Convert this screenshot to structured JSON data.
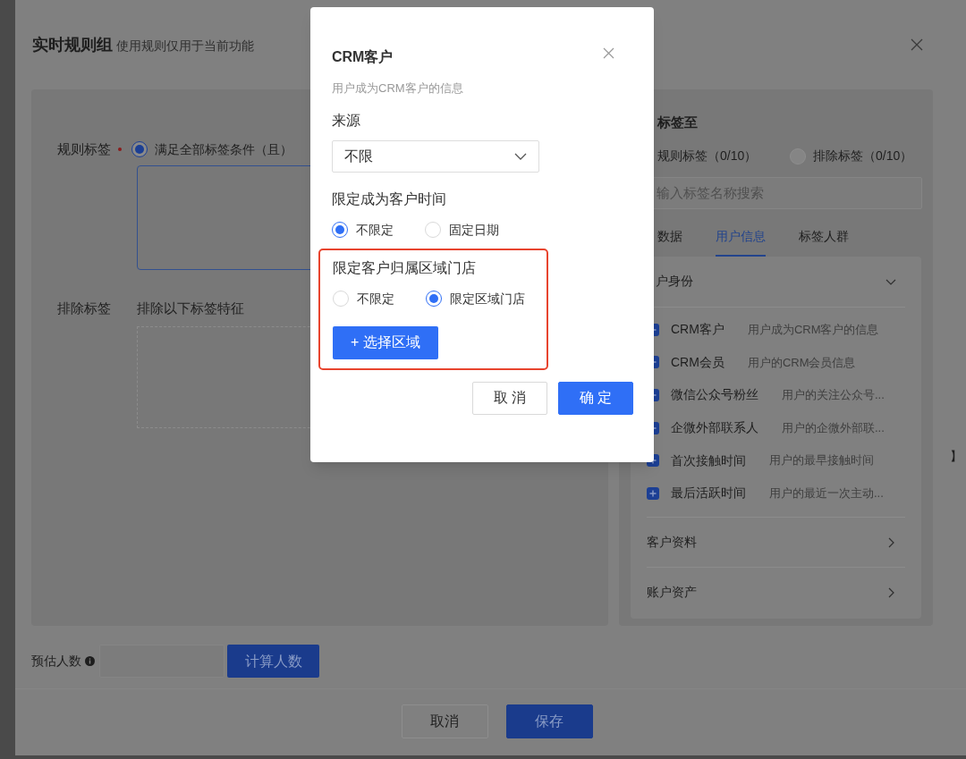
{
  "back_dialog": {
    "title": "实时规则组",
    "subtitle": "使用规则仅用于当前功能",
    "rule_tags": {
      "label": "规则标签",
      "required": true,
      "option": {
        "label": "满足全部标签条件（且）",
        "selected": true
      }
    },
    "exclude_tags": {
      "label": "排除标签",
      "hint": "排除以下标签特征"
    },
    "tag_panel": {
      "heading": "标签至",
      "target_rule": {
        "label": "规则标签（0/10）"
      },
      "target_exclude": {
        "label": "排除标签（0/10）",
        "selected": false
      },
      "search": {
        "placeholder": "输入标签名称搜索"
      },
      "tabs": [
        {
          "label": "数据",
          "selected": false
        },
        {
          "label": "用户信息",
          "selected": true
        },
        {
          "label": "标签人群",
          "selected": false
        }
      ],
      "sections": [
        {
          "title": "户身份",
          "expanded": true,
          "items": [
            {
              "name": "CRM客户",
              "desc": "用户成为CRM客户的信息"
            },
            {
              "name": "CRM会员",
              "desc": "用户的CRM会员信息"
            },
            {
              "name": "微信公众号粉丝",
              "desc": "用户的关注公众号..."
            },
            {
              "name": "企微外部联系人",
              "desc": "用户的企微外部联..."
            },
            {
              "name": "首次接触时间",
              "desc": "用户的最早接触时间"
            },
            {
              "name": "最后活跃时间",
              "desc": "用户的最近一次主动..."
            }
          ]
        },
        {
          "title": "客户资料",
          "expanded": false
        },
        {
          "title": "账户资产",
          "expanded": false
        }
      ]
    },
    "edge_mark": "】",
    "estimate": {
      "label": "预估人数",
      "button": "计算人数"
    },
    "buttons": [
      {
        "label": "取消",
        "kind": "default"
      },
      {
        "label": "保存",
        "kind": "primary"
      }
    ]
  },
  "modal": {
    "title": "CRM客户",
    "subtitle": "用户成为CRM客户的信息",
    "fields": [
      {
        "kind": "select",
        "label": "来源",
        "value": "不限"
      },
      {
        "kind": "radio",
        "label": "限定成为客户时间",
        "highlighted": false,
        "options": [
          {
            "label": "不限定",
            "selected": true
          },
          {
            "label": "固定日期",
            "selected": false
          }
        ]
      },
      {
        "kind": "radio",
        "label": "限定客户归属区域门店",
        "highlighted": true,
        "options": [
          {
            "label": "不限定",
            "selected": false
          },
          {
            "label": "限定区域门店",
            "selected": true
          }
        ],
        "action": "+ 选择区域"
      }
    ],
    "buttons": [
      {
        "label": "取 消",
        "kind": "default"
      },
      {
        "label": "确 定",
        "kind": "primary"
      }
    ]
  }
}
